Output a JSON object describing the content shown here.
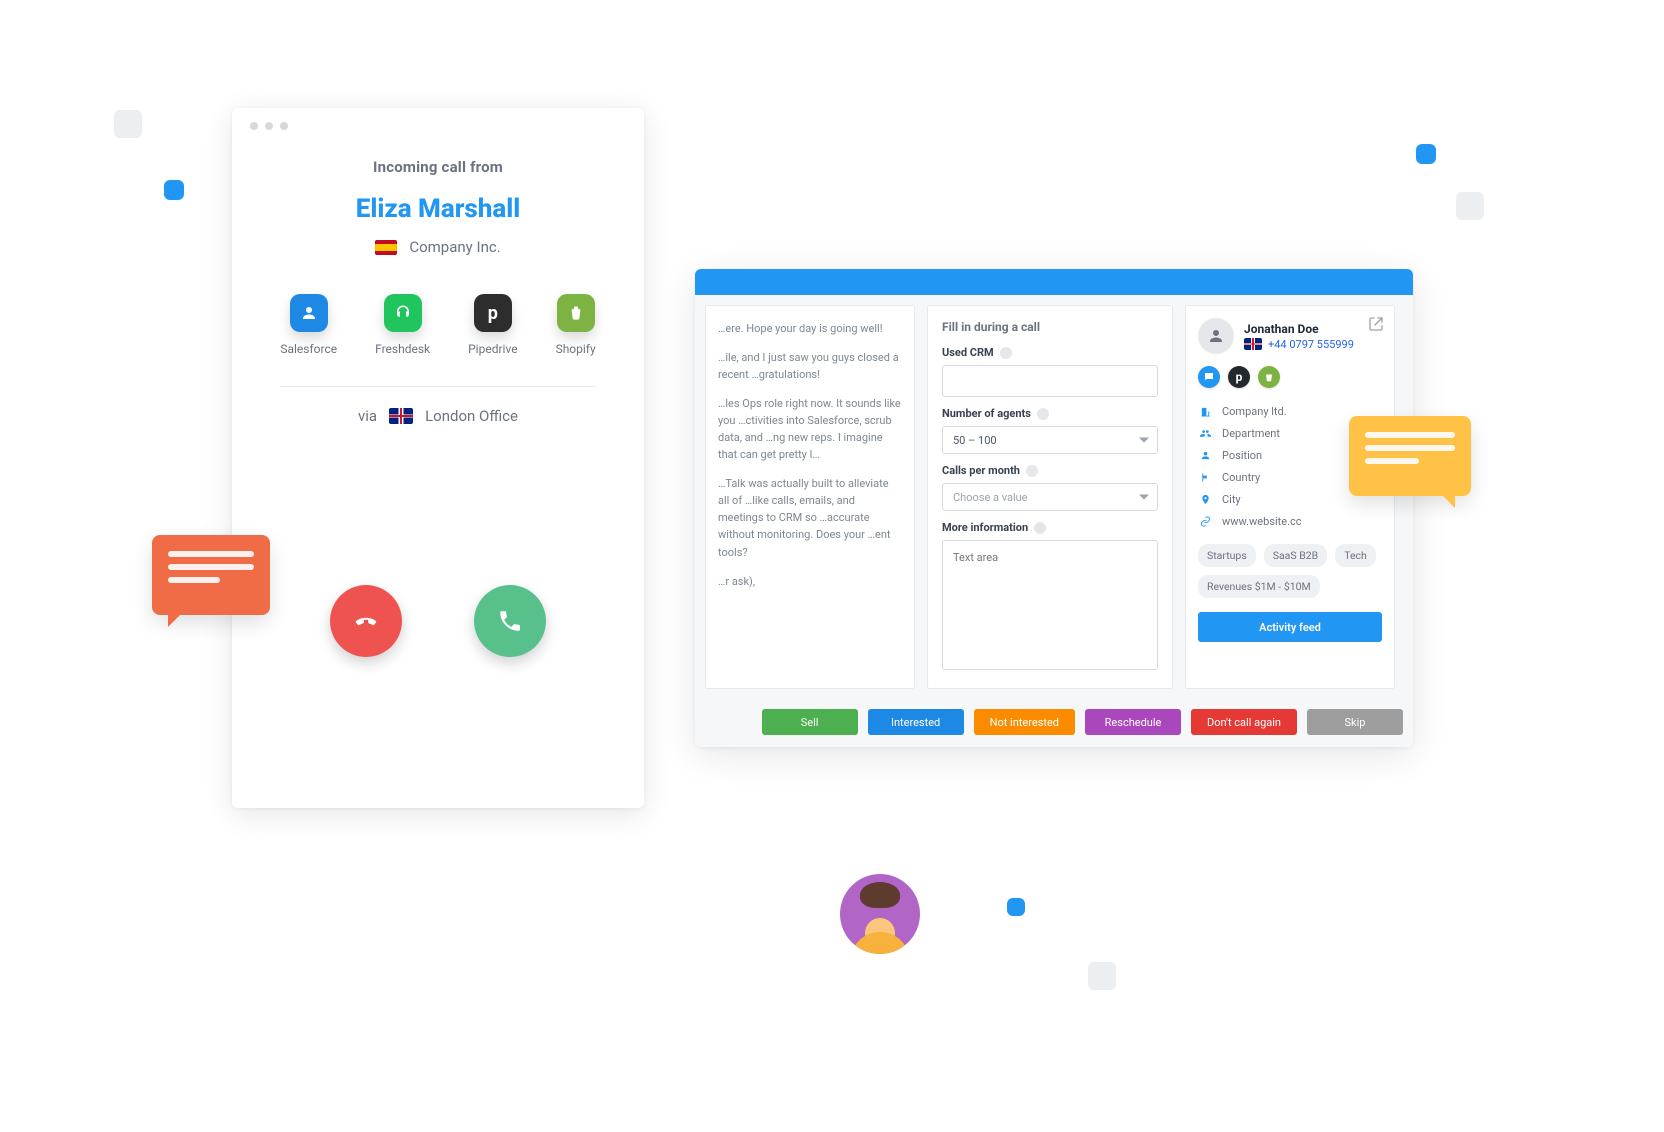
{
  "call": {
    "incoming_label": "Incoming call from",
    "caller_name": "Eliza Marshall",
    "company": "Company Inc.",
    "via_label": "via",
    "office": "London Office"
  },
  "integrations": [
    {
      "label": "Salesforce"
    },
    {
      "label": "Freshdesk"
    },
    {
      "label": "Pipedrive"
    },
    {
      "label": "Shopify"
    }
  ],
  "script": {
    "p1": "…ere. Hope your day is going well!",
    "p2": "…ile, and I just saw you guys closed a recent …gratulations!",
    "p3": "…les Ops role right now. It sounds like you …ctivities into Salesforce, scrub data, and …ng new reps. I imagine that can get pretty l…",
    "p4": "…Talk was actually built to alleviate all of …like calls, emails, and meetings to CRM so …accurate without monitoring. Does your …ent tools?",
    "p5": "…r ask),"
  },
  "form": {
    "title": "Fill in during a call",
    "used_crm_label": "Used CRM",
    "used_crm_value": "",
    "agents_label": "Number of agents",
    "agents_value": "50 – 100",
    "calls_label": "Calls per month",
    "calls_placeholder": "Choose a value",
    "more_label": "More information",
    "textarea_placeholder": "Text area"
  },
  "contact": {
    "name": "Jonathan Doe",
    "phone": "+44 0797 555999",
    "info": {
      "company": "Company ltd.",
      "department": "Department",
      "position": "Position",
      "country": "Country",
      "city": "City",
      "website": "www.website.cc"
    },
    "tags": [
      "Startups",
      "SaaS B2B",
      "Tech",
      "Revenues $1M - $10M"
    ],
    "activity_button": "Activity feed"
  },
  "actions": {
    "sell": "Sell",
    "interested": "Interested",
    "not_interested": "Not interested",
    "reschedule": "Reschedule",
    "dont_call": "Don't call again",
    "skip": "Skip"
  }
}
